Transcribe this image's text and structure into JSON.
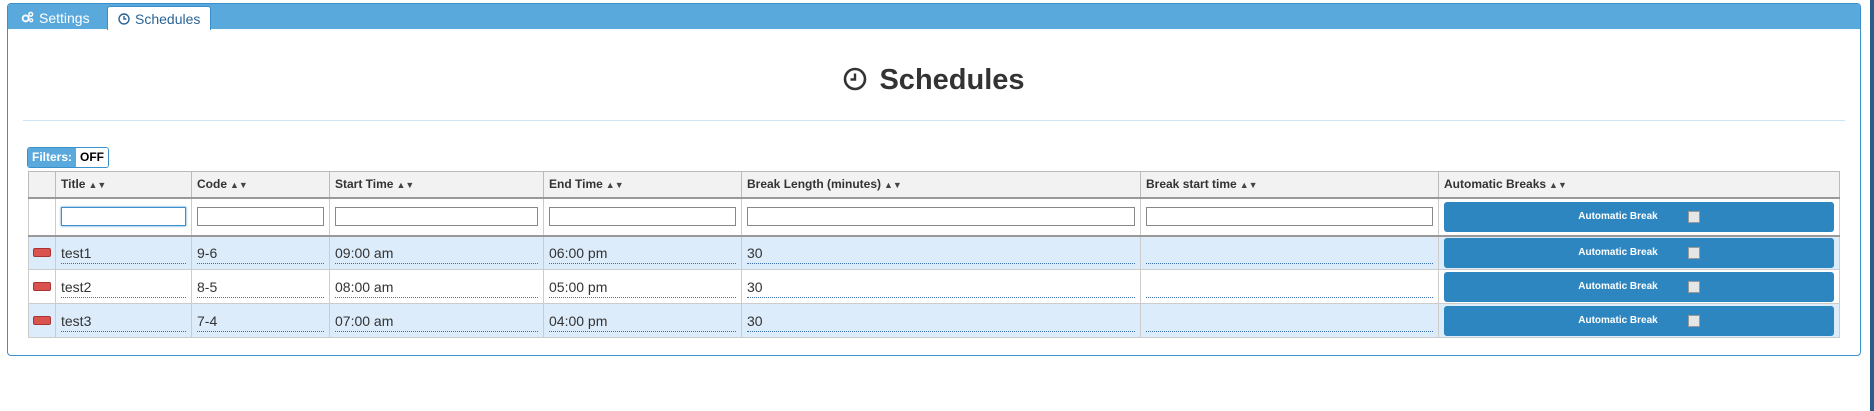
{
  "tabs": [
    {
      "label": "Settings",
      "icon": "gears-icon"
    },
    {
      "label": "Schedules",
      "icon": "clock-icon"
    }
  ],
  "page": {
    "title": "Schedules",
    "title_icon": "clock-icon"
  },
  "filters": {
    "label": "Filters:",
    "state": "OFF"
  },
  "columns": [
    "Title",
    "Code",
    "Start Time",
    "End Time",
    "Break Length (minutes)",
    "Break start time",
    "Automatic Breaks"
  ],
  "rows": [
    {
      "title": "test1",
      "code": "9-6",
      "start": "09:00 am",
      "end": "06:00 pm",
      "break_length": "30",
      "break_start": "",
      "auto_break_label": "Automatic Break",
      "auto_break_checked": false
    },
    {
      "title": "test2",
      "code": "8-5",
      "start": "08:00 am",
      "end": "05:00 pm",
      "break_length": "30",
      "break_start": "",
      "auto_break_label": "Automatic Break",
      "auto_break_checked": false
    },
    {
      "title": "test3",
      "code": "7-4",
      "start": "07:00 am",
      "end": "04:00 pm",
      "break_length": "30",
      "break_start": "",
      "auto_break_label": "Automatic Break",
      "auto_break_checked": false
    }
  ],
  "filter_row": {
    "auto_break_label": "Automatic Break"
  },
  "colors": {
    "accent": "#5aa9dc",
    "button": "#2e86c1",
    "row_highlight": "#dcecfb",
    "remove": "#d9534f"
  }
}
